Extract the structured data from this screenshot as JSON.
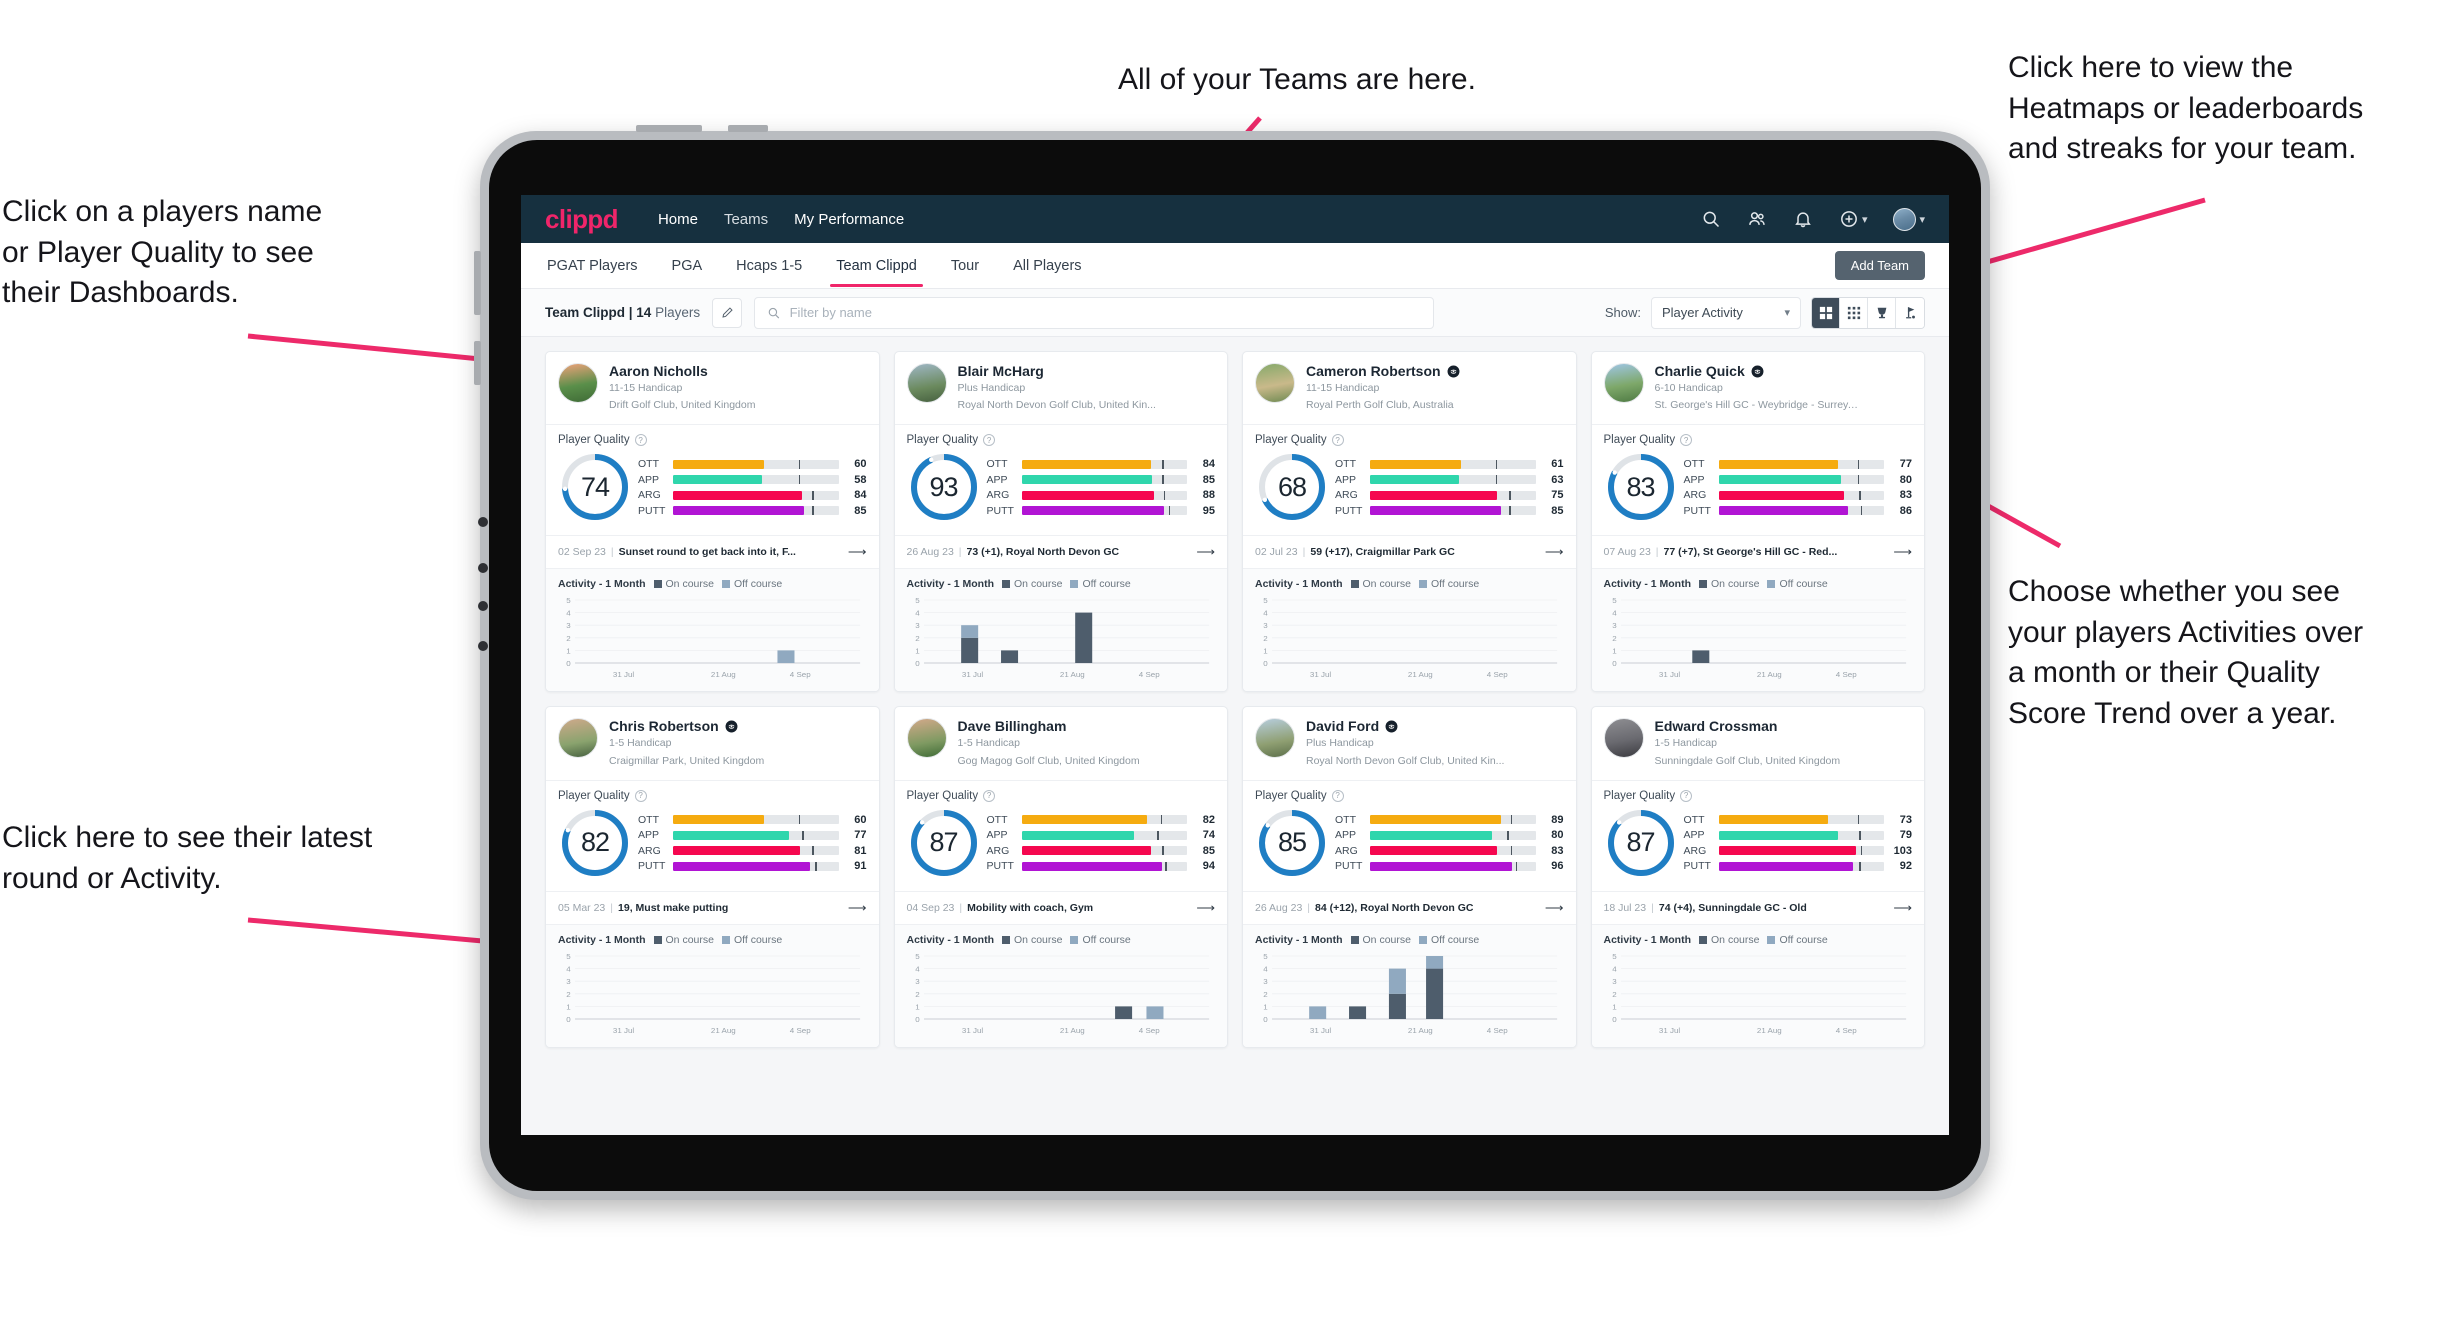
{
  "annotations": {
    "top_center": "All of your Teams are here.",
    "left_top": "Click on a players name\nor Player Quality to see\ntheir Dashboards.",
    "right_top": "Click here to view the\nHeatmaps or leaderboards\nand streaks for your team.",
    "right_mid": "Choose whether you see\nyour players Activities over\na month or their Quality\nScore Trend over a year.",
    "left_bottom": "Click here to see their latest\nround or Activity.",
    "arrow_color": "#ed2a6a"
  },
  "app": {
    "brand": "clippd",
    "nav_links": [
      {
        "label": "Home",
        "active": true
      },
      {
        "label": "Teams",
        "active": false
      },
      {
        "label": "My Performance",
        "active": true
      }
    ],
    "nav_icons": [
      "search-icon",
      "users-icon",
      "bell-icon",
      "plus-circle-icon",
      "avatar"
    ],
    "tabs": [
      {
        "label": "PGAT Players",
        "active": false
      },
      {
        "label": "PGA",
        "active": false
      },
      {
        "label": "Hcaps 1-5",
        "active": false
      },
      {
        "label": "Team Clippd",
        "active": true
      },
      {
        "label": "Tour",
        "active": false
      },
      {
        "label": "All Players",
        "active": false
      }
    ],
    "add_team_label": "Add Team",
    "team_label_bold": "Team Clippd | 14",
    "team_label_rest": " Players",
    "search_placeholder": "Filter by name",
    "search_value": "",
    "show_label": "Show:",
    "show_value": "Player Activity",
    "show_options": [
      "Player Activity",
      "Quality Score Trend"
    ],
    "view_buttons": [
      {
        "name": "grid-large-icon",
        "active": true
      },
      {
        "name": "grid-small-icon",
        "active": false
      },
      {
        "name": "trophy-icon",
        "active": false
      },
      {
        "name": "golf-flag-icon",
        "active": false
      }
    ],
    "theme": {
      "navbar": "#16303f",
      "brand_pink": "#f0256a",
      "ring_blue": "#1f7ec4",
      "ott": "#f5ab10",
      "app": "#2fd6ac",
      "arg": "#f5074f",
      "putt": "#b114d4",
      "on_course": "#4e5d6c",
      "off_course": "#90a9c0"
    }
  },
  "quality_legend": {
    "title": "Player Quality",
    "rows": [
      "OTT",
      "APP",
      "ARG",
      "PUTT"
    ]
  },
  "activity_legend": {
    "title": "Activity - 1 Month",
    "on": "On course",
    "off": "Off course"
  },
  "players": [
    {
      "name": "Aaron Nicholls",
      "verified": false,
      "handicap": "11-15 Handicap",
      "club": "Drift Golf Club, United Kingdom",
      "score": 74,
      "metrics": [
        {
          "key": "OTT",
          "value": 60,
          "fill": 55,
          "mark": 76
        },
        {
          "key": "APP",
          "value": 58,
          "fill": 54,
          "mark": 76
        },
        {
          "key": "ARG",
          "value": 84,
          "fill": 78,
          "mark": 84
        },
        {
          "key": "PUTT",
          "value": 85,
          "fill": 79,
          "mark": 84
        }
      ],
      "last_date": "02 Sep 23",
      "last_desc": "Sunset round to get back into it, F...",
      "chart": {
        "yticks": [
          5,
          4,
          3,
          2,
          1,
          0
        ],
        "xticks": [
          "31 Jul",
          "21 Aug",
          "4 Sep"
        ],
        "bars": [
          {
            "x": 0.74,
            "on": 0,
            "off": 1
          }
        ]
      }
    },
    {
      "name": "Blair McHarg",
      "verified": false,
      "handicap": "Plus Handicap",
      "club": "Royal North Devon Golf Club, United Kin...",
      "score": 93,
      "metrics": [
        {
          "key": "OTT",
          "value": 84,
          "fill": 78,
          "mark": 85
        },
        {
          "key": "APP",
          "value": 85,
          "fill": 79,
          "mark": 85
        },
        {
          "key": "ARG",
          "value": 88,
          "fill": 80,
          "mark": 86
        },
        {
          "key": "PUTT",
          "value": 95,
          "fill": 86,
          "mark": 89
        }
      ],
      "last_date": "26 Aug 23",
      "last_desc": "73 (+1), Royal North Devon GC",
      "chart": {
        "yticks": [
          5,
          4,
          3,
          2,
          1,
          0
        ],
        "xticks": [
          "31 Jul",
          "21 Aug",
          "4 Sep"
        ],
        "bars": [
          {
            "x": 0.16,
            "on": 2,
            "off": 1
          },
          {
            "x": 0.3,
            "on": 1,
            "off": 0
          },
          {
            "x": 0.56,
            "on": 4,
            "off": 0
          }
        ]
      }
    },
    {
      "name": "Cameron Robertson",
      "verified": true,
      "handicap": "11-15 Handicap",
      "club": "Royal Perth Golf Club, Australia",
      "score": 68,
      "metrics": [
        {
          "key": "OTT",
          "value": 61,
          "fill": 55,
          "mark": 76
        },
        {
          "key": "APP",
          "value": 63,
          "fill": 54,
          "mark": 76
        },
        {
          "key": "ARG",
          "value": 75,
          "fill": 77,
          "mark": 84
        },
        {
          "key": "PUTT",
          "value": 85,
          "fill": 79,
          "mark": 84
        }
      ],
      "last_date": "02 Jul 23",
      "last_desc": "59 (+17), Craigmillar Park GC",
      "chart": {
        "yticks": [
          5,
          4,
          3,
          2,
          1,
          0
        ],
        "xticks": [
          "31 Jul",
          "21 Aug",
          "4 Sep"
        ],
        "bars": []
      }
    },
    {
      "name": "Charlie Quick",
      "verified": true,
      "handicap": "6-10 Handicap",
      "club": "St. George's Hill GC - Weybridge - Surrey, ...",
      "score": 83,
      "metrics": [
        {
          "key": "OTT",
          "value": 77,
          "fill": 72,
          "mark": 84
        },
        {
          "key": "APP",
          "value": 80,
          "fill": 74,
          "mark": 84
        },
        {
          "key": "ARG",
          "value": 83,
          "fill": 76,
          "mark": 85
        },
        {
          "key": "PUTT",
          "value": 86,
          "fill": 78,
          "mark": 86
        }
      ],
      "last_date": "07 Aug 23",
      "last_desc": "77 (+7), St George's Hill GC - Red...",
      "chart": {
        "yticks": [
          5,
          4,
          3,
          2,
          1,
          0
        ],
        "xticks": [
          "31 Jul",
          "21 Aug",
          "4 Sep"
        ],
        "bars": [
          {
            "x": 0.28,
            "on": 1,
            "off": 0
          }
        ]
      }
    },
    {
      "name": "Chris Robertson",
      "verified": true,
      "handicap": "1-5 Handicap",
      "club": "Craigmillar Park, United Kingdom",
      "score": 82,
      "metrics": [
        {
          "key": "OTT",
          "value": 60,
          "fill": 55,
          "mark": 76
        },
        {
          "key": "APP",
          "value": 77,
          "fill": 70,
          "mark": 78
        },
        {
          "key": "ARG",
          "value": 81,
          "fill": 77,
          "mark": 84
        },
        {
          "key": "PUTT",
          "value": 91,
          "fill": 83,
          "mark": 86
        }
      ],
      "last_date": "05 Mar 23",
      "last_desc": "19, Must make putting",
      "chart": {
        "yticks": [
          5,
          4,
          3,
          2,
          1,
          0
        ],
        "xticks": [
          "31 Jul",
          "21 Aug",
          "4 Sep"
        ],
        "bars": []
      }
    },
    {
      "name": "Dave Billingham",
      "verified": false,
      "handicap": "1-5 Handicap",
      "club": "Gog Magog Golf Club, United Kingdom",
      "score": 87,
      "metrics": [
        {
          "key": "OTT",
          "value": 82,
          "fill": 76,
          "mark": 84
        },
        {
          "key": "APP",
          "value": 74,
          "fill": 68,
          "mark": 82
        },
        {
          "key": "ARG",
          "value": 85,
          "fill": 78,
          "mark": 85
        },
        {
          "key": "PUTT",
          "value": 94,
          "fill": 85,
          "mark": 87
        }
      ],
      "last_date": "04 Sep 23",
      "last_desc": "Mobility with coach, Gym",
      "chart": {
        "yticks": [
          5,
          4,
          3,
          2,
          1,
          0
        ],
        "xticks": [
          "31 Jul",
          "21 Aug",
          "4 Sep"
        ],
        "bars": [
          {
            "x": 0.7,
            "on": 1,
            "off": 0
          },
          {
            "x": 0.81,
            "on": 0,
            "off": 1
          }
        ]
      }
    },
    {
      "name": "David Ford",
      "verified": true,
      "handicap": "Plus Handicap",
      "club": "Royal North Devon Golf Club, United Kin...",
      "score": 85,
      "metrics": [
        {
          "key": "OTT",
          "value": 89,
          "fill": 79,
          "mark": 85
        },
        {
          "key": "APP",
          "value": 80,
          "fill": 74,
          "mark": 83
        },
        {
          "key": "ARG",
          "value": 83,
          "fill": 77,
          "mark": 85
        },
        {
          "key": "PUTT",
          "value": 96,
          "fill": 86,
          "mark": 88
        }
      ],
      "last_date": "26 Aug 23",
      "last_desc": "84 (+12), Royal North Devon GC",
      "chart": {
        "yticks": [
          5,
          4,
          3,
          2,
          1,
          0
        ],
        "xticks": [
          "31 Jul",
          "21 Aug",
          "4 Sep"
        ],
        "bars": [
          {
            "x": 0.16,
            "on": 0,
            "off": 1
          },
          {
            "x": 0.3,
            "on": 1,
            "off": 0
          },
          {
            "x": 0.44,
            "on": 2,
            "off": 2
          },
          {
            "x": 0.57,
            "on": 4,
            "off": 1
          }
        ]
      }
    },
    {
      "name": "Edward Crossman",
      "verified": false,
      "handicap": "1-5 Handicap",
      "club": "Sunningdale Golf Club, United Kingdom",
      "score": 87,
      "metrics": [
        {
          "key": "OTT",
          "value": 73,
          "fill": 66,
          "mark": 84
        },
        {
          "key": "APP",
          "value": 79,
          "fill": 72,
          "mark": 85
        },
        {
          "key": "ARG",
          "value": 103,
          "fill": 83,
          "mark": 86
        },
        {
          "key": "PUTT",
          "value": 92,
          "fill": 81,
          "mark": 85
        }
      ],
      "last_date": "18 Jul 23",
      "last_desc": "74 (+4), Sunningdale GC - Old",
      "chart": {
        "yticks": [
          5,
          4,
          3,
          2,
          1,
          0
        ],
        "xticks": [
          "31 Jul",
          "21 Aug",
          "4 Sep"
        ],
        "bars": []
      }
    }
  ]
}
